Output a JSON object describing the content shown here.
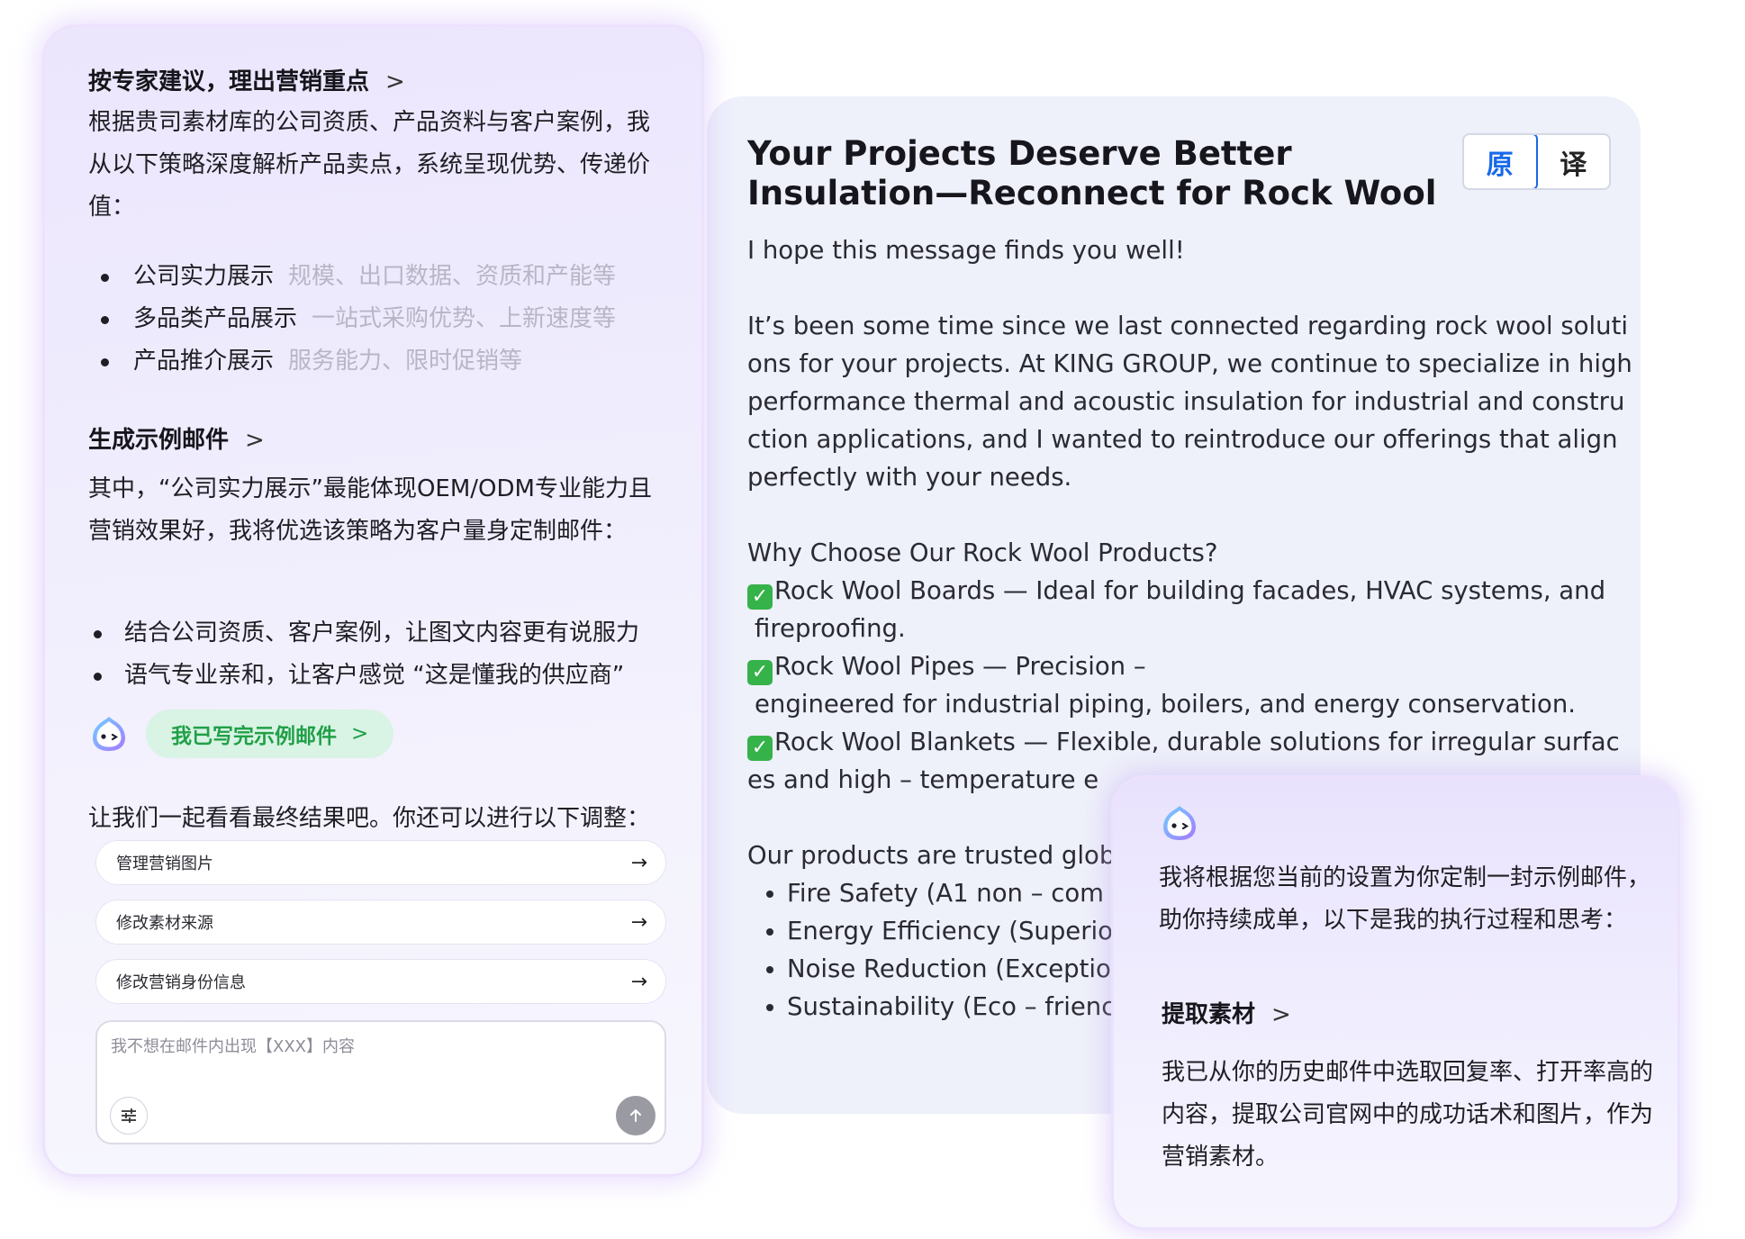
{
  "email": {
    "title": "Your Projects Deserve Better Insulation—Reconnect for Rock Wool",
    "lang_original": "原",
    "lang_translate": "译",
    "greeting": "I hope this message finds you well!",
    "intro": "It’s been some time since we last connected regarding rock wool solutions for your projects. At KING GROUP, we continue to specialize in highperformance thermal and acoustic insulation for industrial and construction applications, and I wanted to reintroduce our offerings that align perfectly with your needs.",
    "why_heading": "Why Choose Our Rock Wool Products?",
    "products": [
      {
        "line1": "Rock Wool Boards — Ideal for building facades, HVAC systems, and",
        "line2": "fireproofing."
      },
      {
        "line1": "Rock Wool Pipes — Precision –",
        "line2": "engineered for industrial piping, boilers, and energy conservation."
      },
      {
        "line1": "Rock Wool Blankets — Flexible, durable solutions for irregular surfaces and high – temperature e"
      }
    ],
    "trusted_line": "Our products are trusted glob",
    "features": [
      "Fire Safety (A1 non – com",
      "Energy Efficiency (Superio",
      "Noise Reduction (Exceptio",
      "Sustainability (Eco – frienc"
    ]
  },
  "left_panel": {
    "section1_title": "按专家建议，理出营销重点",
    "section1_desc": "根据贵司素材库的公司资质、产品资料与客户案例，我从以下策略深度解析产品卖点，系统呈现优势、传递价值：",
    "strategies": [
      {
        "label": "公司实力展示",
        "hint": "规模、出口数据、资质和产能等"
      },
      {
        "label": "多品类产品展示",
        "hint": "一站式采购优势、上新速度等"
      },
      {
        "label": "产品推介展示",
        "hint": "服务能力、限时促销等"
      }
    ],
    "section2_title": "生成示例邮件",
    "section2_desc": "其中，“公司实力展示”最能体现OEM/ODM专业能力且营销效果好，我将优选该策略为客户量身定制邮件：",
    "points": [
      "结合公司资质、客户案例，让图文内容更有说服力",
      "语气专业亲和，让客户感觉 “这是懂我的供应商”"
    ],
    "done_button": "我已写完示例邮件",
    "followup": "让我们一起看看最终结果吧。你还可以进行以下调整：",
    "actions": [
      "管理营销图片",
      "修改素材来源",
      "修改营销身份信息"
    ],
    "input_placeholder": "我不想在邮件内出现【XXX】内容"
  },
  "popup": {
    "intro": "我将根据您当前的设置为你定制一封示例邮件，助你持续成单，以下是我的执行过程和思考：",
    "step_title": "提取素材",
    "step_desc": "我已从你的历史邮件中选取回复率、打开率高的内容，提取公司官网中的成功话术和图片，作为营销素材。"
  },
  "colors": {
    "accent_blue": "#1769e8",
    "success_green": "#21a047",
    "panel_lavender": "#ece6fd"
  }
}
